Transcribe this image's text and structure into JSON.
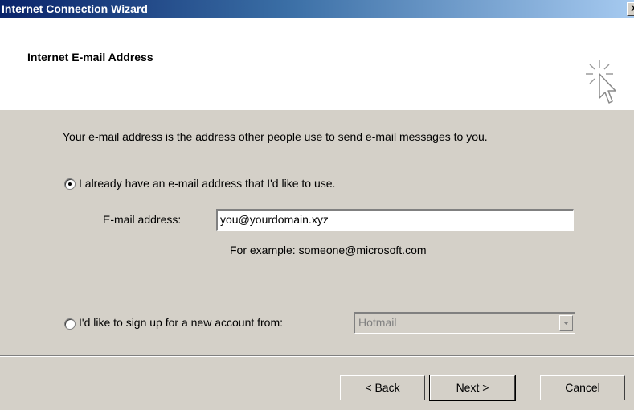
{
  "window": {
    "title": "Internet Connection Wizard",
    "close_label": "X"
  },
  "header": {
    "title": "Internet E-mail Address",
    "icon": "wizard-cursor-icon"
  },
  "content": {
    "description": "Your e-mail address is the address other people use to send e-mail messages to you.",
    "option_existing": {
      "label": "I already have an e-mail address that I'd like to use.",
      "selected": true
    },
    "email_field": {
      "label": "E-mail address:",
      "value": "you@yourdomain.xyz"
    },
    "example": "For example: someone@microsoft.com",
    "option_new": {
      "label": "I'd like to sign up for a new account from:",
      "selected": false
    },
    "provider_select": {
      "value": "Hotmail",
      "disabled": true
    }
  },
  "footer": {
    "back_label": "< Back",
    "next_label": "Next >",
    "cancel_label": "Cancel"
  }
}
